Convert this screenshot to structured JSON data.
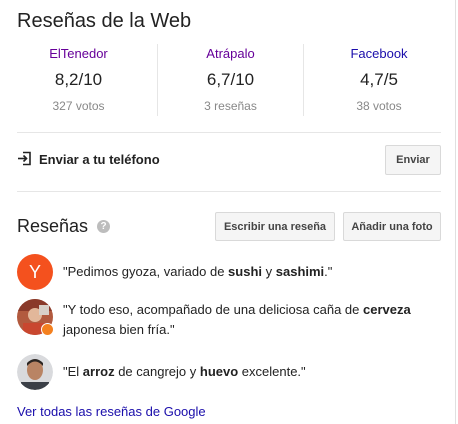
{
  "title": "Reseñas de la Web",
  "ratings": [
    {
      "source": "ElTenedor",
      "score": "8,2/10",
      "count": "327 votos"
    },
    {
      "source": "Atrápalo",
      "score": "6,7/10",
      "count": "3 reseñas"
    },
    {
      "source": "Facebook",
      "score": "4,7/5",
      "count": "38 votos"
    }
  ],
  "send": {
    "label": "Enviar a tu teléfono",
    "button": "Enviar"
  },
  "reviews": {
    "heading": "Reseñas",
    "help": "?",
    "write_button": "Escribir una reseña",
    "photo_button": "Añadir una foto",
    "items": [
      {
        "avatar_letter": "Y",
        "parts": [
          "\"Pedimos gyoza, variado de ",
          "sushi",
          " y ",
          "sashimi",
          ".\""
        ]
      },
      {
        "parts": [
          "\"Y todo eso, acompañado de una deliciosa caña de ",
          "cerveza",
          " japonesa bien fría.\""
        ]
      },
      {
        "parts": [
          "\"El ",
          "arroz",
          " de cangrejo y ",
          "huevo",
          " excelente.\""
        ]
      }
    ],
    "all_link": "Ver todas las reseñas de Google"
  },
  "colors": {
    "visited_link": "#660099",
    "link": "#1a0dab",
    "avatar_y": "#f4511e",
    "badge": "#f4801f"
  }
}
